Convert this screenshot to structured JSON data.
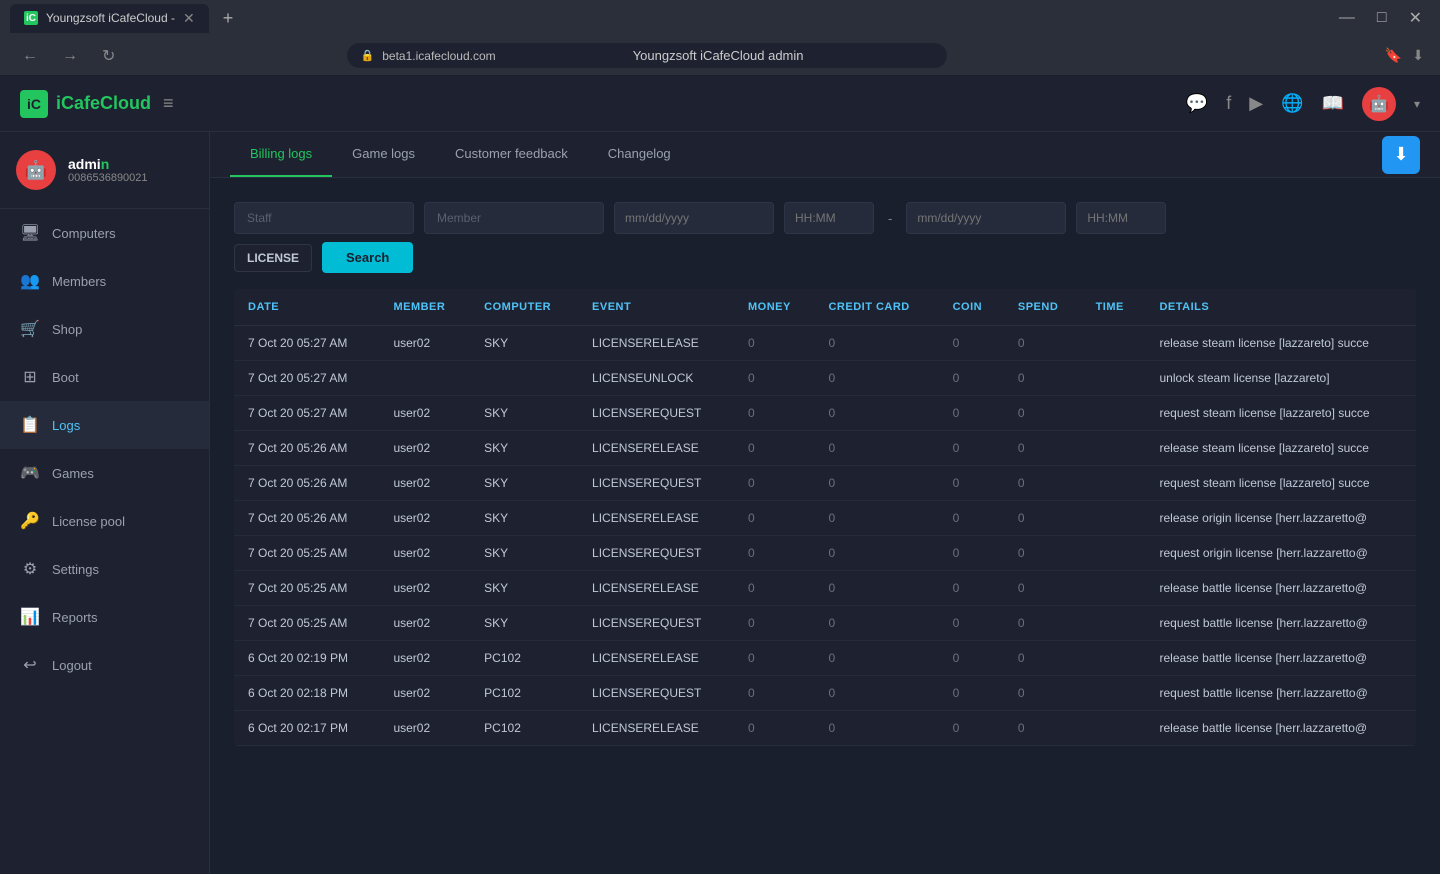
{
  "browser": {
    "tab_title": "Youngzsoft iCafeCloud -",
    "url": "beta1.icafecloud.com",
    "page_title": "Youngzsoft iCafeCloud admin",
    "new_tab_icon": "+",
    "controls": [
      "—",
      "□",
      "✕"
    ]
  },
  "header": {
    "logo_text": "iCafeCloud",
    "logo_abbr": "iC",
    "hamburger": "≡",
    "icons": [
      "discord",
      "facebook",
      "youtube",
      "globe",
      "book"
    ],
    "avatar_initial": "🤖",
    "dropdown_arrow": "▾"
  },
  "sidebar": {
    "user": {
      "name": "admin",
      "name_highlight": "n",
      "id": "0086536890021",
      "avatar_initial": "🤖"
    },
    "items": [
      {
        "id": "computers",
        "label": "Computers",
        "icon": "🖥"
      },
      {
        "id": "members",
        "label": "Members",
        "icon": "👥"
      },
      {
        "id": "shop",
        "label": "Shop",
        "icon": "🛒"
      },
      {
        "id": "boot",
        "label": "Boot",
        "icon": "⊞"
      },
      {
        "id": "logs",
        "label": "Logs",
        "icon": "📋",
        "active": true
      },
      {
        "id": "games",
        "label": "Games",
        "icon": "🎮"
      },
      {
        "id": "license-pool",
        "label": "License pool",
        "icon": "🔑"
      },
      {
        "id": "settings",
        "label": "Settings",
        "icon": "⚙"
      },
      {
        "id": "reports",
        "label": "Reports",
        "icon": "📊"
      },
      {
        "id": "logout",
        "label": "Logout",
        "icon": "↩"
      }
    ]
  },
  "tabs": [
    {
      "id": "billing-logs",
      "label": "Billing logs",
      "active": true
    },
    {
      "id": "game-logs",
      "label": "Game logs",
      "active": false
    },
    {
      "id": "customer-feedback",
      "label": "Customer feedback",
      "active": false
    },
    {
      "id": "changelog",
      "label": "Changelog",
      "active": false
    }
  ],
  "download_btn_icon": "⬇",
  "filters": {
    "staff_placeholder": "Staff",
    "member_placeholder": "Member",
    "date_placeholder_start": "mm/dd/yyyy",
    "date_placeholder_end": "mm/dd/yyyy",
    "time_placeholder_start": "HH:MM",
    "time_placeholder_end": "HH:MM",
    "license_filter": "LICENSE",
    "search_label": "Search"
  },
  "table": {
    "columns": [
      "DATE",
      "MEMBER",
      "COMPUTER",
      "EVENT",
      "MONEY",
      "CREDIT CARD",
      "COIN",
      "SPEND",
      "TIME",
      "DETAILS"
    ],
    "rows": [
      {
        "date": "7 Oct 20 05:27 AM",
        "member": "user02",
        "computer": "SKY",
        "event": "LICENSERELEASE",
        "money": "0",
        "credit_card": "0",
        "coin": "0",
        "spend": "0",
        "time": "",
        "details": "release steam license [lazzareto] succe"
      },
      {
        "date": "7 Oct 20 05:27 AM",
        "member": "",
        "computer": "",
        "event": "LICENSEUNLOCK",
        "money": "0",
        "credit_card": "0",
        "coin": "0",
        "spend": "0",
        "time": "",
        "details": "unlock steam license [lazzareto]"
      },
      {
        "date": "7 Oct 20 05:27 AM",
        "member": "user02",
        "computer": "SKY",
        "event": "LICENSEREQUEST",
        "money": "0",
        "credit_card": "0",
        "coin": "0",
        "spend": "0",
        "time": "",
        "details": "request steam license [lazzareto] succe"
      },
      {
        "date": "7 Oct 20 05:26 AM",
        "member": "user02",
        "computer": "SKY",
        "event": "LICENSERELEASE",
        "money": "0",
        "credit_card": "0",
        "coin": "0",
        "spend": "0",
        "time": "",
        "details": "release steam license [lazzareto] succe"
      },
      {
        "date": "7 Oct 20 05:26 AM",
        "member": "user02",
        "computer": "SKY",
        "event": "LICENSEREQUEST",
        "money": "0",
        "credit_card": "0",
        "coin": "0",
        "spend": "0",
        "time": "",
        "details": "request steam license [lazzareto] succe"
      },
      {
        "date": "7 Oct 20 05:26 AM",
        "member": "user02",
        "computer": "SKY",
        "event": "LICENSERELEASE",
        "money": "0",
        "credit_card": "0",
        "coin": "0",
        "spend": "0",
        "time": "",
        "details": "release origin license [herr.lazzaretto@"
      },
      {
        "date": "7 Oct 20 05:25 AM",
        "member": "user02",
        "computer": "SKY",
        "event": "LICENSEREQUEST",
        "money": "0",
        "credit_card": "0",
        "coin": "0",
        "spend": "0",
        "time": "",
        "details": "request origin license [herr.lazzaretto@"
      },
      {
        "date": "7 Oct 20 05:25 AM",
        "member": "user02",
        "computer": "SKY",
        "event": "LICENSERELEASE",
        "money": "0",
        "credit_card": "0",
        "coin": "0",
        "spend": "0",
        "time": "",
        "details": "release battle license [herr.lazzaretto@"
      },
      {
        "date": "7 Oct 20 05:25 AM",
        "member": "user02",
        "computer": "SKY",
        "event": "LICENSEREQUEST",
        "money": "0",
        "credit_card": "0",
        "coin": "0",
        "spend": "0",
        "time": "",
        "details": "request battle license [herr.lazzaretto@"
      },
      {
        "date": "6 Oct 20 02:19 PM",
        "member": "user02",
        "computer": "PC102",
        "event": "LICENSERELEASE",
        "money": "0",
        "credit_card": "0",
        "coin": "0",
        "spend": "0",
        "time": "",
        "details": "release battle license [herr.lazzaretto@"
      },
      {
        "date": "6 Oct 20 02:18 PM",
        "member": "user02",
        "computer": "PC102",
        "event": "LICENSEREQUEST",
        "money": "0",
        "credit_card": "0",
        "coin": "0",
        "spend": "0",
        "time": "",
        "details": "request battle license [herr.lazzaretto@"
      },
      {
        "date": "6 Oct 20 02:17 PM",
        "member": "user02",
        "computer": "PC102",
        "event": "LICENSERELEASE",
        "money": "0",
        "credit_card": "0",
        "coin": "0",
        "spend": "0",
        "time": "",
        "details": "release battle license [herr.lazzaretto@"
      }
    ]
  }
}
